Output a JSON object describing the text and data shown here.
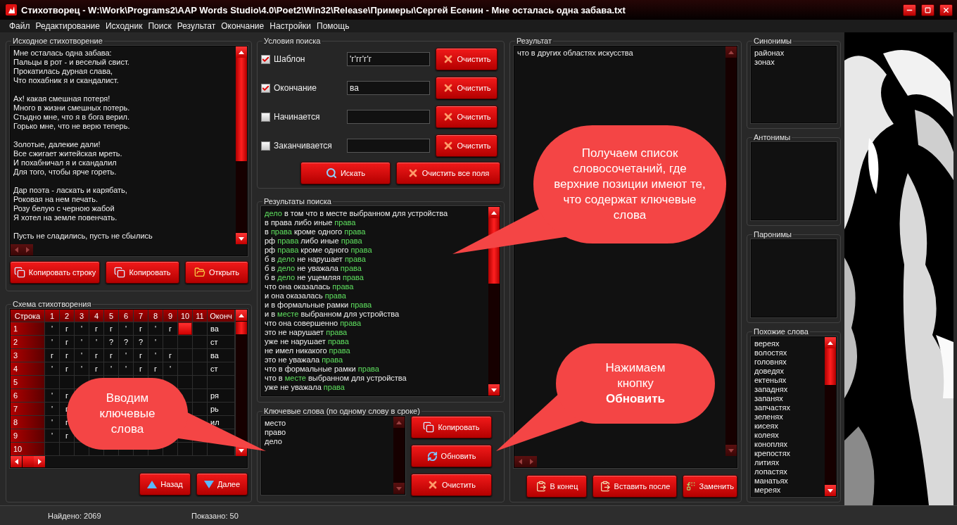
{
  "window": {
    "title": "Стихотворец - W:\\Work\\Programs2\\AAP Words Studio\\4.0\\Poet2\\Win32\\Release\\Примеры\\Сергей Есенин - Мне осталась одна забава.txt"
  },
  "menu": [
    "Файл",
    "Редактирование",
    "Исходник",
    "Поиск",
    "Результат",
    "Окончание",
    "Настройки",
    "Помощь"
  ],
  "source_poem": {
    "title": "Исходное стихотворение",
    "stanzas": [
      [
        "Мне осталась одна забава:",
        "Пальцы в рот - и веселый свист.",
        "Прокатилась дурная слава,",
        "Что похабник я и скандалист."
      ],
      [
        "Ах! какая смешная потеря!",
        "Много в жизни смешных потерь.",
        "Стыдно мне, что я в бога верил.",
        "Горько мне, что не верю теперь."
      ],
      [
        "Золотые, далекие дали!",
        "Все сжигает житейская мреть.",
        "И похабничал я и скандалил",
        "Для того, чтобы ярче гореть."
      ],
      [
        "Дар поэта - ласкать и карябать,",
        "Роковая на нем печать.",
        "Розу белую с черною жабой",
        "Я хотел на земле повенчать."
      ],
      [
        "Пусть не сладились, пусть не сбылись"
      ]
    ],
    "buttons": [
      "Копировать строку",
      "Копировать",
      "Открыть"
    ]
  },
  "scheme": {
    "title": "Схема стихотворения",
    "columns": [
      "Строка",
      "1",
      "2",
      "3",
      "4",
      "5",
      "6",
      "7",
      "8",
      "9",
      "10",
      "11",
      "Оконч"
    ],
    "rows": [
      {
        "cells": [
          "1",
          "'",
          "г",
          "'",
          "г",
          "г",
          "'",
          "г",
          "'",
          "г",
          "",
          "",
          "ва"
        ],
        "selected": [
          false,
          false,
          false,
          false,
          false,
          false,
          false,
          false,
          false,
          false,
          true,
          false,
          false
        ]
      },
      {
        "cells": [
          "2",
          "'",
          "г",
          "'",
          "'",
          "?",
          "?",
          "?",
          "'",
          "",
          "",
          "",
          "ст"
        ],
        "selected": [
          false,
          false,
          false,
          false,
          false,
          false,
          false,
          false,
          false,
          false,
          false,
          false,
          false
        ]
      },
      {
        "cells": [
          "3",
          "г",
          "г",
          "'",
          "г",
          "г",
          "'",
          "г",
          "'",
          "г",
          "",
          "",
          "ва"
        ],
        "selected": [
          false,
          false,
          false,
          false,
          false,
          false,
          false,
          false,
          false,
          false,
          false,
          false,
          false
        ]
      },
      {
        "cells": [
          "4",
          "'",
          "г",
          "'",
          "г",
          "'",
          "'",
          "г",
          "г",
          "'",
          "",
          "",
          "ст"
        ],
        "selected": [
          false,
          false,
          false,
          false,
          false,
          false,
          false,
          false,
          false,
          false,
          false,
          false,
          false
        ]
      },
      {
        "cells": [
          "5",
          "",
          "",
          "",
          "",
          "",
          "",
          "",
          "",
          "",
          "",
          "",
          ""
        ]
      },
      {
        "cells": [
          "6",
          "'",
          "г",
          "",
          "",
          "",
          "",
          "",
          "",
          "",
          "",
          "",
          "ря"
        ]
      },
      {
        "cells": [
          "7",
          "'",
          "г",
          "",
          "",
          "",
          "",
          "",
          "",
          "",
          "",
          "",
          "рь"
        ]
      },
      {
        "cells": [
          "8",
          "'",
          "г",
          "",
          "",
          "",
          "",
          "",
          "",
          "",
          "",
          "",
          "ил"
        ]
      },
      {
        "cells": [
          "9",
          "'",
          "г",
          "",
          "",
          "",
          "",
          "",
          "",
          "",
          "",
          "",
          ""
        ]
      },
      {
        "cells": [
          "10",
          "",
          "",
          "",
          "",
          "",
          "",
          "",
          "",
          "",
          "",
          "",
          ""
        ]
      }
    ],
    "buttons": [
      "Назад",
      "Далее"
    ]
  },
  "search_conditions": {
    "title": "Условия поиска",
    "filters": [
      {
        "label": "Шаблон",
        "checked": true,
        "value": "'г'гг'г'г",
        "clear_button": "Очистить"
      },
      {
        "label": "Окончание",
        "checked": true,
        "value": "ва",
        "clear_button": "Очистить"
      },
      {
        "label": "Начинается",
        "checked": false,
        "clear_button": "Очистить"
      },
      {
        "label": "Заканчивается",
        "checked": false,
        "clear_button": "Очистить"
      }
    ],
    "search_button": "Искать",
    "clear_all_button": "Очистить все поля"
  },
  "search_results": {
    "title": "Результаты поиска",
    "rows": [
      [
        {
          "text": "дело",
          "match": true
        },
        {
          "text": " в том что в месте выбранном для устройства",
          "match": false
        }
      ],
      [
        {
          "text": "в права либо иные ",
          "match": false
        },
        {
          "text": "права",
          "match": true
        }
      ],
      [
        {
          "text": "в ",
          "match": false
        },
        {
          "text": "права",
          "match": true
        },
        {
          "text": " кроме одного ",
          "match": false
        },
        {
          "text": "права",
          "match": true
        }
      ],
      [
        {
          "text": "рф ",
          "match": false
        },
        {
          "text": "права",
          "match": true
        },
        {
          "text": " либо иные ",
          "match": false
        },
        {
          "text": "права",
          "match": true
        }
      ],
      [
        {
          "text": "рф ",
          "match": false
        },
        {
          "text": "права",
          "match": true
        },
        {
          "text": " кроме одного ",
          "match": false
        },
        {
          "text": "права",
          "match": true
        }
      ],
      [
        {
          "text": "б в ",
          "match": false
        },
        {
          "text": "дело",
          "match": true
        },
        {
          "text": " не нарушает ",
          "match": false
        },
        {
          "text": "права",
          "match": true
        }
      ],
      [
        {
          "text": "б в ",
          "match": false
        },
        {
          "text": "дело",
          "match": true
        },
        {
          "text": " не уважала ",
          "match": false
        },
        {
          "text": "права",
          "match": true
        }
      ],
      [
        {
          "text": "б в ",
          "match": false
        },
        {
          "text": "дело",
          "match": true
        },
        {
          "text": " не ущемляя ",
          "match": false
        },
        {
          "text": "права",
          "match": true
        }
      ],
      [
        {
          "text": "что она оказалась ",
          "match": false
        },
        {
          "text": "права",
          "match": true
        }
      ],
      [
        {
          "text": "и она оказалась ",
          "match": false
        },
        {
          "text": "права",
          "match": true
        }
      ],
      [
        {
          "text": "и в формальные рамки ",
          "match": false
        },
        {
          "text": "права",
          "match": true
        }
      ],
      [
        {
          "text": "и в ",
          "match": false
        },
        {
          "text": "месте",
          "match": true
        },
        {
          "text": " выбранном для устройства",
          "match": false
        }
      ],
      [
        {
          "text": "что она совершенно ",
          "match": false
        },
        {
          "text": "права",
          "match": true
        }
      ],
      [
        {
          "text": "это не нарушает ",
          "match": false
        },
        {
          "text": "права",
          "match": true
        }
      ],
      [
        {
          "text": "уже не нарушает ",
          "match": false
        },
        {
          "text": "права",
          "match": true
        }
      ],
      [
        {
          "text": "не имел никакого ",
          "match": false
        },
        {
          "text": "права",
          "match": true
        }
      ],
      [
        {
          "text": "это не уважала ",
          "match": false
        },
        {
          "text": "права",
          "match": true
        }
      ],
      [
        {
          "text": "что в формальные рамки ",
          "match": false
        },
        {
          "text": "права",
          "match": true
        }
      ],
      [
        {
          "text": "что в ",
          "match": false
        },
        {
          "text": "месте",
          "match": true
        },
        {
          "text": " выбранном для устройства",
          "match": false
        }
      ],
      [
        {
          "text": "уже не уважала ",
          "match": false
        },
        {
          "text": "права",
          "match": true
        }
      ]
    ]
  },
  "keywords": {
    "title": "Ключевые слова (по одному слову в сроке)",
    "words": [
      "место",
      "право",
      "дело"
    ],
    "buttons": [
      "Копировать",
      "Обновить",
      "Очистить"
    ]
  },
  "result": {
    "title": "Результат",
    "text": "что в других областях искусства",
    "buttons": [
      "В конец",
      "Вставить после",
      "Заменить"
    ]
  },
  "synonyms": {
    "title": "Синонимы",
    "words": [
      "районах",
      "зонах"
    ]
  },
  "antonyms": {
    "title": "Антонимы"
  },
  "paronyms": {
    "title": "Паронимы"
  },
  "similar_words": {
    "title": "Похожие слова",
    "words": [
      "вереях",
      "волостях",
      "головнях",
      "доведях",
      "ектеньях",
      "западнях",
      "запанях",
      "запчастях",
      "зеленях",
      "кисеях",
      "колеях",
      "коноплях",
      "крепостях",
      "литиях",
      "лопастях",
      "манатьях",
      "мереях"
    ]
  },
  "callouts": [
    {
      "text": "Получаем список словосочетаний, где верхние позиции имеют те, что содержат ключевые слова"
    },
    {
      "text": "Нажимаем кнопку **Обновить**"
    },
    {
      "text": "Вводим ключевые слова"
    }
  ],
  "status_bar": [
    "Найдено: 2069",
    "Показано: 50"
  ]
}
